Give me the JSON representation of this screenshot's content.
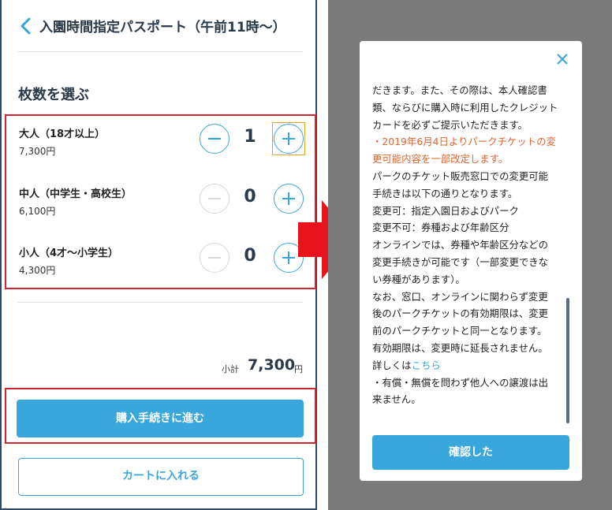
{
  "header": {
    "title": "入園時間指定パスポート（午前11時〜）"
  },
  "section": {
    "title": "枚数を選ぶ"
  },
  "tickets": [
    {
      "label": "大人（18才以上）",
      "price": "7,300円",
      "quantity": "1"
    },
    {
      "label": "中人（中学生・高校生）",
      "price": "6,100円",
      "quantity": "0"
    },
    {
      "label": "小人（4才〜小学生）",
      "price": "4,300円",
      "quantity": "0"
    }
  ],
  "subtotal": {
    "label": "小計",
    "value": "7,300",
    "unit": "円"
  },
  "buttons": {
    "purchase": "購入手続きに進む",
    "cart": "カートに入れる",
    "confirm": "確認した"
  },
  "modal": {
    "lines": [
      {
        "text": "だきます。また、その際は、本人確認書",
        "style": ""
      },
      {
        "text": "類、ならびに購入時に利用したクレジット",
        "style": ""
      },
      {
        "text": "カードを必ずご提示いただきます。",
        "style": ""
      },
      {
        "text": "・2019年6月4日よりパークチケットの変",
        "style": "orange"
      },
      {
        "text": "更可能内容を一部改定します。",
        "style": "orange"
      },
      {
        "text": "パークのチケット販売窓口での変更可能",
        "style": ""
      },
      {
        "text": "手続きは以下の通りとなります。",
        "style": ""
      },
      {
        "text": "変更可：指定入園日およびパーク",
        "style": ""
      },
      {
        "text": "変更不可：券種および年齢区分",
        "style": ""
      },
      {
        "text": "オンラインでは、券種や年齢区分などの",
        "style": ""
      },
      {
        "text": "変更手続きが可能です（一部変更できな",
        "style": ""
      },
      {
        "text": "い券種があります）。",
        "style": ""
      },
      {
        "text": "なお、窓口、オンラインに関わらず変更",
        "style": ""
      },
      {
        "text": "後のパークチケットの有効期限は、変更",
        "style": ""
      },
      {
        "text": "前のパークチケットと同一となります。",
        "style": ""
      },
      {
        "text": "有効期限は、変更時に延長されません。",
        "style": ""
      },
      {
        "text": "詳しくは",
        "style": "",
        "link": "こちら"
      },
      {
        "text": "・有償・無償を問わず他人への譲渡は出",
        "style": ""
      },
      {
        "text": "来ません。",
        "style": ""
      }
    ]
  },
  "colors": {
    "accent": "#3aa7dc",
    "highlight": "#d0242f",
    "notice": "#e0642e",
    "overlay": "#7a7a7a"
  },
  "icons": {
    "back": "chevron-left-icon",
    "minus": "minus-circle-icon",
    "plus": "plus-circle-icon",
    "close": "close-icon",
    "arrow": "arrow-right-icon"
  }
}
